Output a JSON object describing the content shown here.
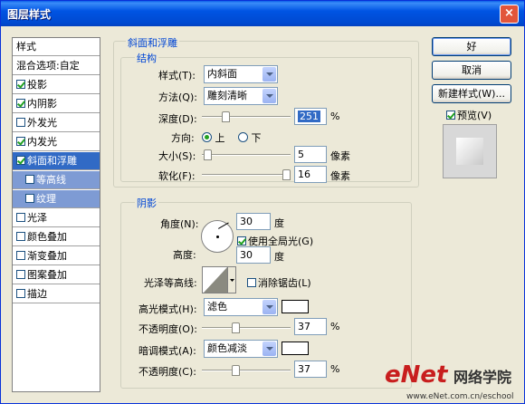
{
  "window": {
    "title": "图层样式",
    "close_glyph": "×"
  },
  "styles_list": {
    "header": "样式",
    "blend": "混合选项:自定",
    "items": [
      {
        "label": "投影",
        "checked": true
      },
      {
        "label": "内阴影",
        "checked": true
      },
      {
        "label": "外发光",
        "checked": false
      },
      {
        "label": "内发光",
        "checked": true
      },
      {
        "label": "斜面和浮雕",
        "checked": true,
        "selected": true
      },
      {
        "label": "等高线",
        "checked": false,
        "sub": true
      },
      {
        "label": "纹理",
        "checked": false,
        "sub": true
      },
      {
        "label": "光泽",
        "checked": false
      },
      {
        "label": "颜色叠加",
        "checked": false
      },
      {
        "label": "渐变叠加",
        "checked": false
      },
      {
        "label": "图案叠加",
        "checked": false
      },
      {
        "label": "描边",
        "checked": false
      }
    ]
  },
  "bevel": {
    "group_title": "斜面和浮雕",
    "structure_title": "结构",
    "style_label": "样式(T):",
    "style_value": "内斜面",
    "technique_label": "方法(Q):",
    "technique_value": "雕刻清晰",
    "depth_label": "深度(D):",
    "depth_value": "251",
    "depth_unit": "%",
    "depth_slider": 0.25,
    "direction_label": "方向:",
    "direction_up": "上",
    "direction_down": "下",
    "size_label": "大小(S):",
    "size_value": "5",
    "size_unit": "像素",
    "size_slider": 0.02,
    "soften_label": "软化(F):",
    "soften_value": "16",
    "soften_unit": "像素",
    "soften_slider": 1.0
  },
  "shading": {
    "title": "阴影",
    "angle_label": "角度(N):",
    "angle_value": "30",
    "angle_unit": "度",
    "global_light_label": "使用全局光(G)",
    "global_light_checked": true,
    "altitude_label": "高度:",
    "altitude_value": "30",
    "altitude_unit": "度",
    "gloss_label": "光泽等高线:",
    "antialias_label": "消除锯齿(L)",
    "antialias_checked": false,
    "highlight_label": "高光模式(H):",
    "highlight_value": "滤色",
    "highlight_color": "#ffffff",
    "hl_opacity_label": "不透明度(O):",
    "hl_opacity_value": "37",
    "hl_opacity_unit": "%",
    "hl_opacity_slider": 0.37,
    "shadow_label": "暗调模式(A):",
    "shadow_value": "颜色减淡",
    "shadow_color": "#ffffff",
    "sh_opacity_label": "不透明度(C):",
    "sh_opacity_value": "37",
    "sh_opacity_unit": "%",
    "sh_opacity_slider": 0.37
  },
  "buttons": {
    "ok": "好",
    "cancel": "取消",
    "new_style": "新建样式(W)...",
    "preview": "预览(V)",
    "preview_checked": true
  },
  "watermark": {
    "logo": "eNet",
    "site_cn": "网络学院",
    "url": "www.eNet.com.cn/eschool"
  }
}
